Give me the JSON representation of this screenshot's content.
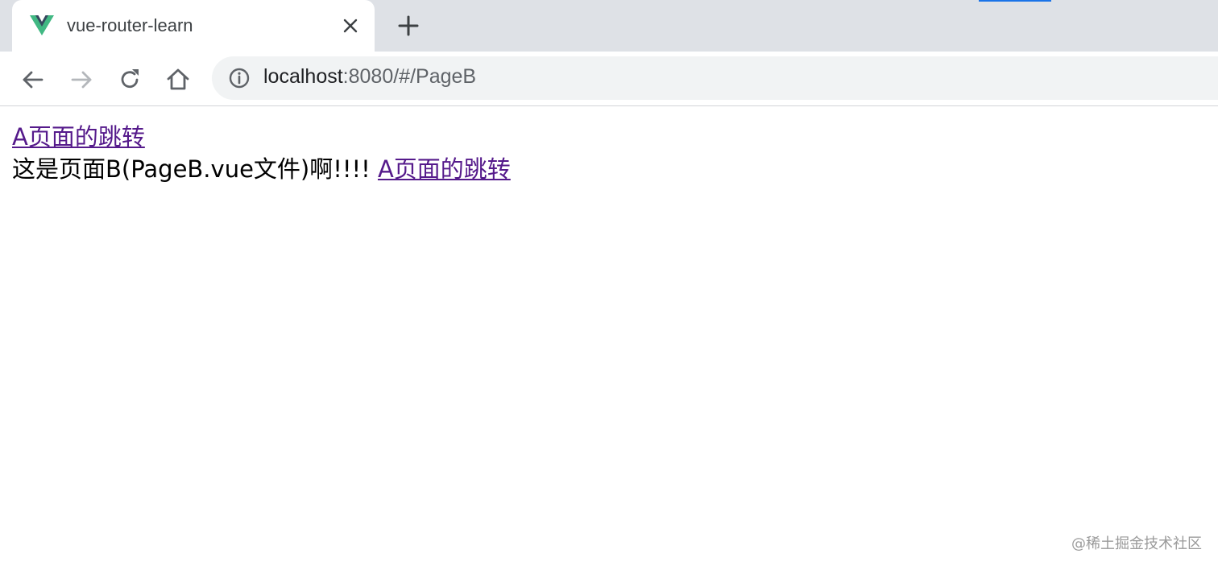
{
  "browser": {
    "tab": {
      "title": "vue-router-learn",
      "favicon": "vue-logo-icon"
    },
    "close_icon": "close-icon",
    "new_tab_icon": "plus-icon",
    "nav": {
      "back_icon": "arrow-left-icon",
      "forward_icon": "arrow-right-icon",
      "reload_icon": "reload-icon",
      "home_icon": "home-icon"
    },
    "address_bar": {
      "info_icon": "info-icon",
      "host": "localhost",
      "rest": ":8080/#/PageB"
    }
  },
  "page": {
    "link_top": "A页面的跳转",
    "text": "这是页面B(PageB.vue文件)啊!!!! ",
    "link_inline": "A页面的跳转"
  },
  "watermark": "@稀土掘金技术社区",
  "colors": {
    "link_visited": "#551a8b",
    "tabstrip_bg": "#dee1e6",
    "omnibox_bg": "#f1f3f4",
    "vue_green": "#41b883",
    "vue_dark": "#35495e"
  }
}
